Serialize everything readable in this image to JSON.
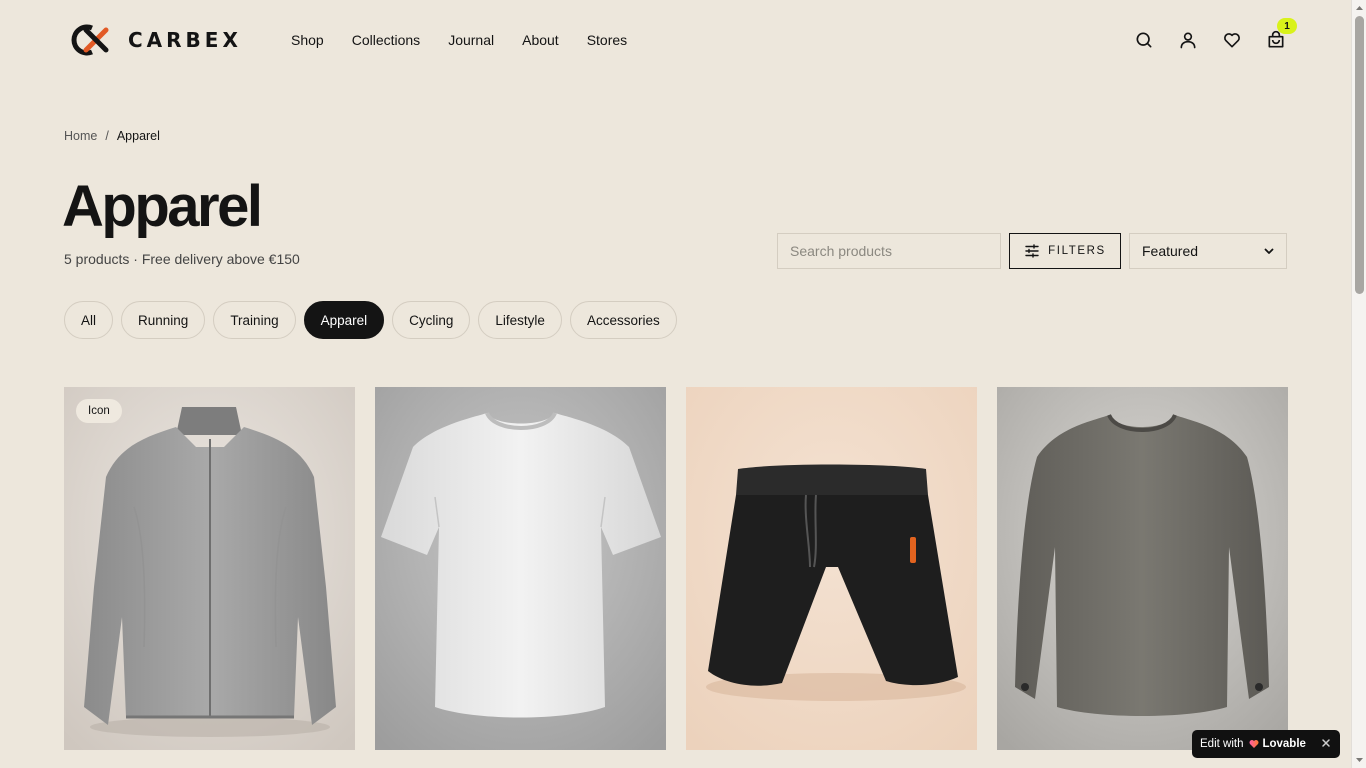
{
  "brand": {
    "name": "CARBEX",
    "accent": "#e25a25"
  },
  "nav": [
    {
      "label": "Shop"
    },
    {
      "label": "Collections"
    },
    {
      "label": "Journal"
    },
    {
      "label": "About"
    },
    {
      "label": "Stores"
    }
  ],
  "header": {
    "icons": [
      "search-icon",
      "account-icon",
      "wishlist-icon",
      "cart-icon"
    ],
    "cart_count": "1"
  },
  "breadcrumb": {
    "home": "Home",
    "separator": "/",
    "current": "Apparel"
  },
  "page": {
    "title": "Apparel",
    "subtitle": "5 products · Free delivery above €150"
  },
  "controls": {
    "search_placeholder": "Search products",
    "filters_label": "FILTERS",
    "sort_value": "Featured"
  },
  "categories": [
    {
      "label": "All",
      "active": false
    },
    {
      "label": "Running",
      "active": false
    },
    {
      "label": "Training",
      "active": false
    },
    {
      "label": "Apparel",
      "active": true
    },
    {
      "label": "Cycling",
      "active": false
    },
    {
      "label": "Lifestyle",
      "active": false
    },
    {
      "label": "Accessories",
      "active": false
    }
  ],
  "products": [
    {
      "image": "grey-jacket-image",
      "badge": "Icon"
    },
    {
      "image": "white-tshirt-image",
      "badge": ""
    },
    {
      "image": "black-shorts-image",
      "badge": ""
    },
    {
      "image": "grey-longsleeve-image",
      "badge": ""
    }
  ],
  "lovable": {
    "prefix": "Edit with",
    "brand": "Lovable"
  }
}
